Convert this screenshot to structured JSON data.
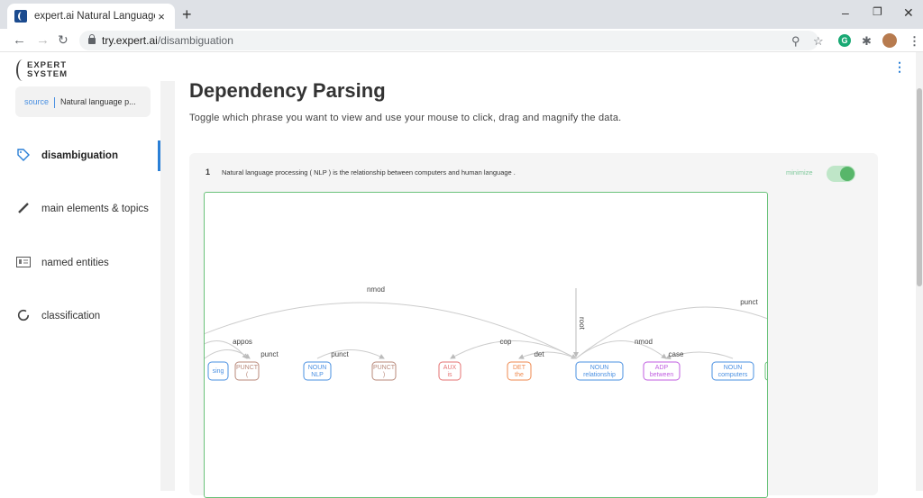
{
  "browser": {
    "tab_title": "expert.ai Natural Language API D",
    "tab_close": "×",
    "new_tab": "+",
    "url_host": "try.expert.ai",
    "url_path": "/disambiguation",
    "win_min": "–",
    "win_max": "❐",
    "win_close": "✕"
  },
  "logo": {
    "line1": "EXPERT",
    "line2": "SYSTEM"
  },
  "source": {
    "label": "source",
    "value": "Natural language p..."
  },
  "menu": [
    {
      "label": "disambiguation",
      "icon": "tag-icon",
      "active": true
    },
    {
      "label": "main elements & topics",
      "icon": "brush-icon"
    },
    {
      "label": "named entities",
      "icon": "id-card-icon"
    },
    {
      "label": "classification",
      "icon": "ring-icon"
    }
  ],
  "page": {
    "title": "Dependency Parsing",
    "subtitle": "Toggle which phrase you want to view and use your mouse to click, drag and magnify the data."
  },
  "phrase": {
    "number": "1",
    "text": "Natural language processing ( NLP ) is the relationship between computers and human language .",
    "minimize_label": "minimize",
    "toggle_on": true
  },
  "graph": {
    "nodes": [
      {
        "pos": "",
        "word": "sing",
        "color": "#4a90e2"
      },
      {
        "pos": "PUNCT",
        "word": "(",
        "color": "#b8897a"
      },
      {
        "pos": "NOUN",
        "word": "NLP",
        "color": "#4a90e2"
      },
      {
        "pos": "PUNCT",
        "word": ")",
        "color": "#b8897a"
      },
      {
        "pos": "AUX",
        "word": "is",
        "color": "#e57373"
      },
      {
        "pos": "DET",
        "word": "the",
        "color": "#ef8a4f"
      },
      {
        "pos": "NOUN",
        "word": "relationship",
        "color": "#4a90e2"
      },
      {
        "pos": "ADP",
        "word": "between",
        "color": "#c05ee0"
      },
      {
        "pos": "NOUN",
        "word": "computers",
        "color": "#4a90e2"
      }
    ],
    "edges": [
      {
        "label": "nmod"
      },
      {
        "label": "punct"
      },
      {
        "label": "appos"
      },
      {
        "label": "punct"
      },
      {
        "label": "punct"
      },
      {
        "label": "cop"
      },
      {
        "label": "det"
      },
      {
        "label": "root"
      },
      {
        "label": "nmod"
      },
      {
        "label": "case"
      }
    ]
  }
}
